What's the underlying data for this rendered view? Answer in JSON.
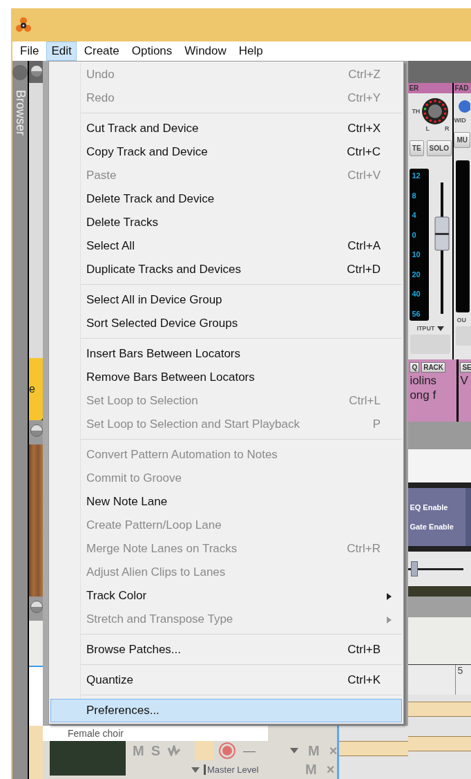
{
  "menu_bar": [
    {
      "label": "File",
      "selected": false
    },
    {
      "label": "Edit",
      "selected": true
    },
    {
      "label": "Create",
      "selected": false
    },
    {
      "label": "Options",
      "selected": false
    },
    {
      "label": "Window",
      "selected": false
    },
    {
      "label": "Help",
      "selected": false
    }
  ],
  "sidebar": {
    "label": "Browser"
  },
  "rack": {
    "left_label": "e"
  },
  "mixer": [
    {
      "header": "ER",
      "knob_label": "TH",
      "pan_labels": [
        "L",
        "R"
      ],
      "buttons": [
        "TE",
        "SOLO"
      ],
      "meter_scale": [
        "12",
        "8",
        "4",
        "0",
        "10",
        "20",
        "40",
        "56"
      ],
      "output": "ITPUT"
    },
    {
      "header": "FAD",
      "knob_label": "WID",
      "buttons": [
        "MU"
      ],
      "output": "OU"
    }
  ],
  "rack_strips": [
    {
      "buttons": [
        "Q",
        "RACK"
      ],
      "name_lines": [
        "iolins",
        "ong f"
      ]
    },
    {
      "buttons": [
        "SE"
      ],
      "name_lines": [
        "V"
      ]
    }
  ],
  "device_panel": {
    "labels": [
      "EQ Enable",
      "Gate Enable"
    ],
    "slider": {
      "level": 0.05
    }
  },
  "ruler": {
    "marks": [
      "5"
    ]
  },
  "track": {
    "name": "Female choir",
    "buttons": [
      "M",
      "S"
    ],
    "lane_dash": "—",
    "lane_buttons": [
      "M",
      "×"
    ],
    "automation": {
      "label": "Master Level",
      "buttons": [
        "M",
        "×"
      ]
    }
  },
  "edit_menu": {
    "groups": [
      [
        {
          "label": "Undo",
          "shortcut": "Ctrl+Z",
          "disabled": true,
          "submenu": false,
          "selected": false
        },
        {
          "label": "Redo",
          "shortcut": "Ctrl+Y",
          "disabled": true,
          "submenu": false,
          "selected": false
        }
      ],
      [
        {
          "label": "Cut Track and Device",
          "shortcut": "Ctrl+X",
          "disabled": false,
          "submenu": false,
          "selected": false
        },
        {
          "label": "Copy Track and Device",
          "shortcut": "Ctrl+C",
          "disabled": false,
          "submenu": false,
          "selected": false
        },
        {
          "label": "Paste",
          "shortcut": "Ctrl+V",
          "disabled": true,
          "submenu": false,
          "selected": false
        },
        {
          "label": "Delete Track and Device",
          "disabled": false,
          "submenu": false,
          "selected": false
        },
        {
          "label": "Delete Tracks",
          "disabled": false,
          "submenu": false,
          "selected": false
        },
        {
          "label": "Select All",
          "shortcut": "Ctrl+A",
          "disabled": false,
          "submenu": false,
          "selected": false
        },
        {
          "label": "Duplicate Tracks and Devices",
          "shortcut": "Ctrl+D",
          "disabled": false,
          "submenu": false,
          "selected": false
        }
      ],
      [
        {
          "label": "Select All in Device Group",
          "disabled": false,
          "submenu": false,
          "selected": false
        },
        {
          "label": "Sort Selected Device Groups",
          "disabled": false,
          "submenu": false,
          "selected": false
        }
      ],
      [
        {
          "label": "Insert Bars Between Locators",
          "disabled": false,
          "submenu": false,
          "selected": false
        },
        {
          "label": "Remove Bars Between Locators",
          "disabled": false,
          "submenu": false,
          "selected": false
        },
        {
          "label": "Set Loop to Selection",
          "shortcut": "Ctrl+L",
          "disabled": true,
          "submenu": false,
          "selected": false
        },
        {
          "label": "Set Loop to Selection and Start Playback",
          "shortcut": "P",
          "disabled": true,
          "submenu": false,
          "selected": false
        }
      ],
      [
        {
          "label": "Convert Pattern Automation to Notes",
          "disabled": true,
          "submenu": false,
          "selected": false
        },
        {
          "label": "Commit to Groove",
          "disabled": true,
          "submenu": false,
          "selected": false
        },
        {
          "label": "New Note Lane",
          "disabled": false,
          "submenu": false,
          "selected": false
        },
        {
          "label": "Create Pattern/Loop Lane",
          "disabled": true,
          "submenu": false,
          "selected": false
        },
        {
          "label": "Merge Note Lanes on Tracks",
          "shortcut": "Ctrl+R",
          "disabled": true,
          "submenu": false,
          "selected": false
        },
        {
          "label": "Adjust Alien Clips to Lanes",
          "disabled": true,
          "submenu": false,
          "selected": false
        },
        {
          "label": "Track Color",
          "disabled": false,
          "submenu": true,
          "selected": false
        },
        {
          "label": "Stretch and Transpose Type",
          "disabled": true,
          "submenu": true,
          "selected": false
        }
      ],
      [
        {
          "label": "Browse Patches...",
          "shortcut": "Ctrl+B",
          "disabled": false,
          "submenu": false,
          "selected": false
        }
      ],
      [
        {
          "label": "Quantize",
          "shortcut": "Ctrl+K",
          "disabled": false,
          "submenu": false,
          "selected": false
        }
      ],
      [
        {
          "label": "Preferences...",
          "disabled": false,
          "submenu": false,
          "selected": true
        }
      ]
    ]
  }
}
